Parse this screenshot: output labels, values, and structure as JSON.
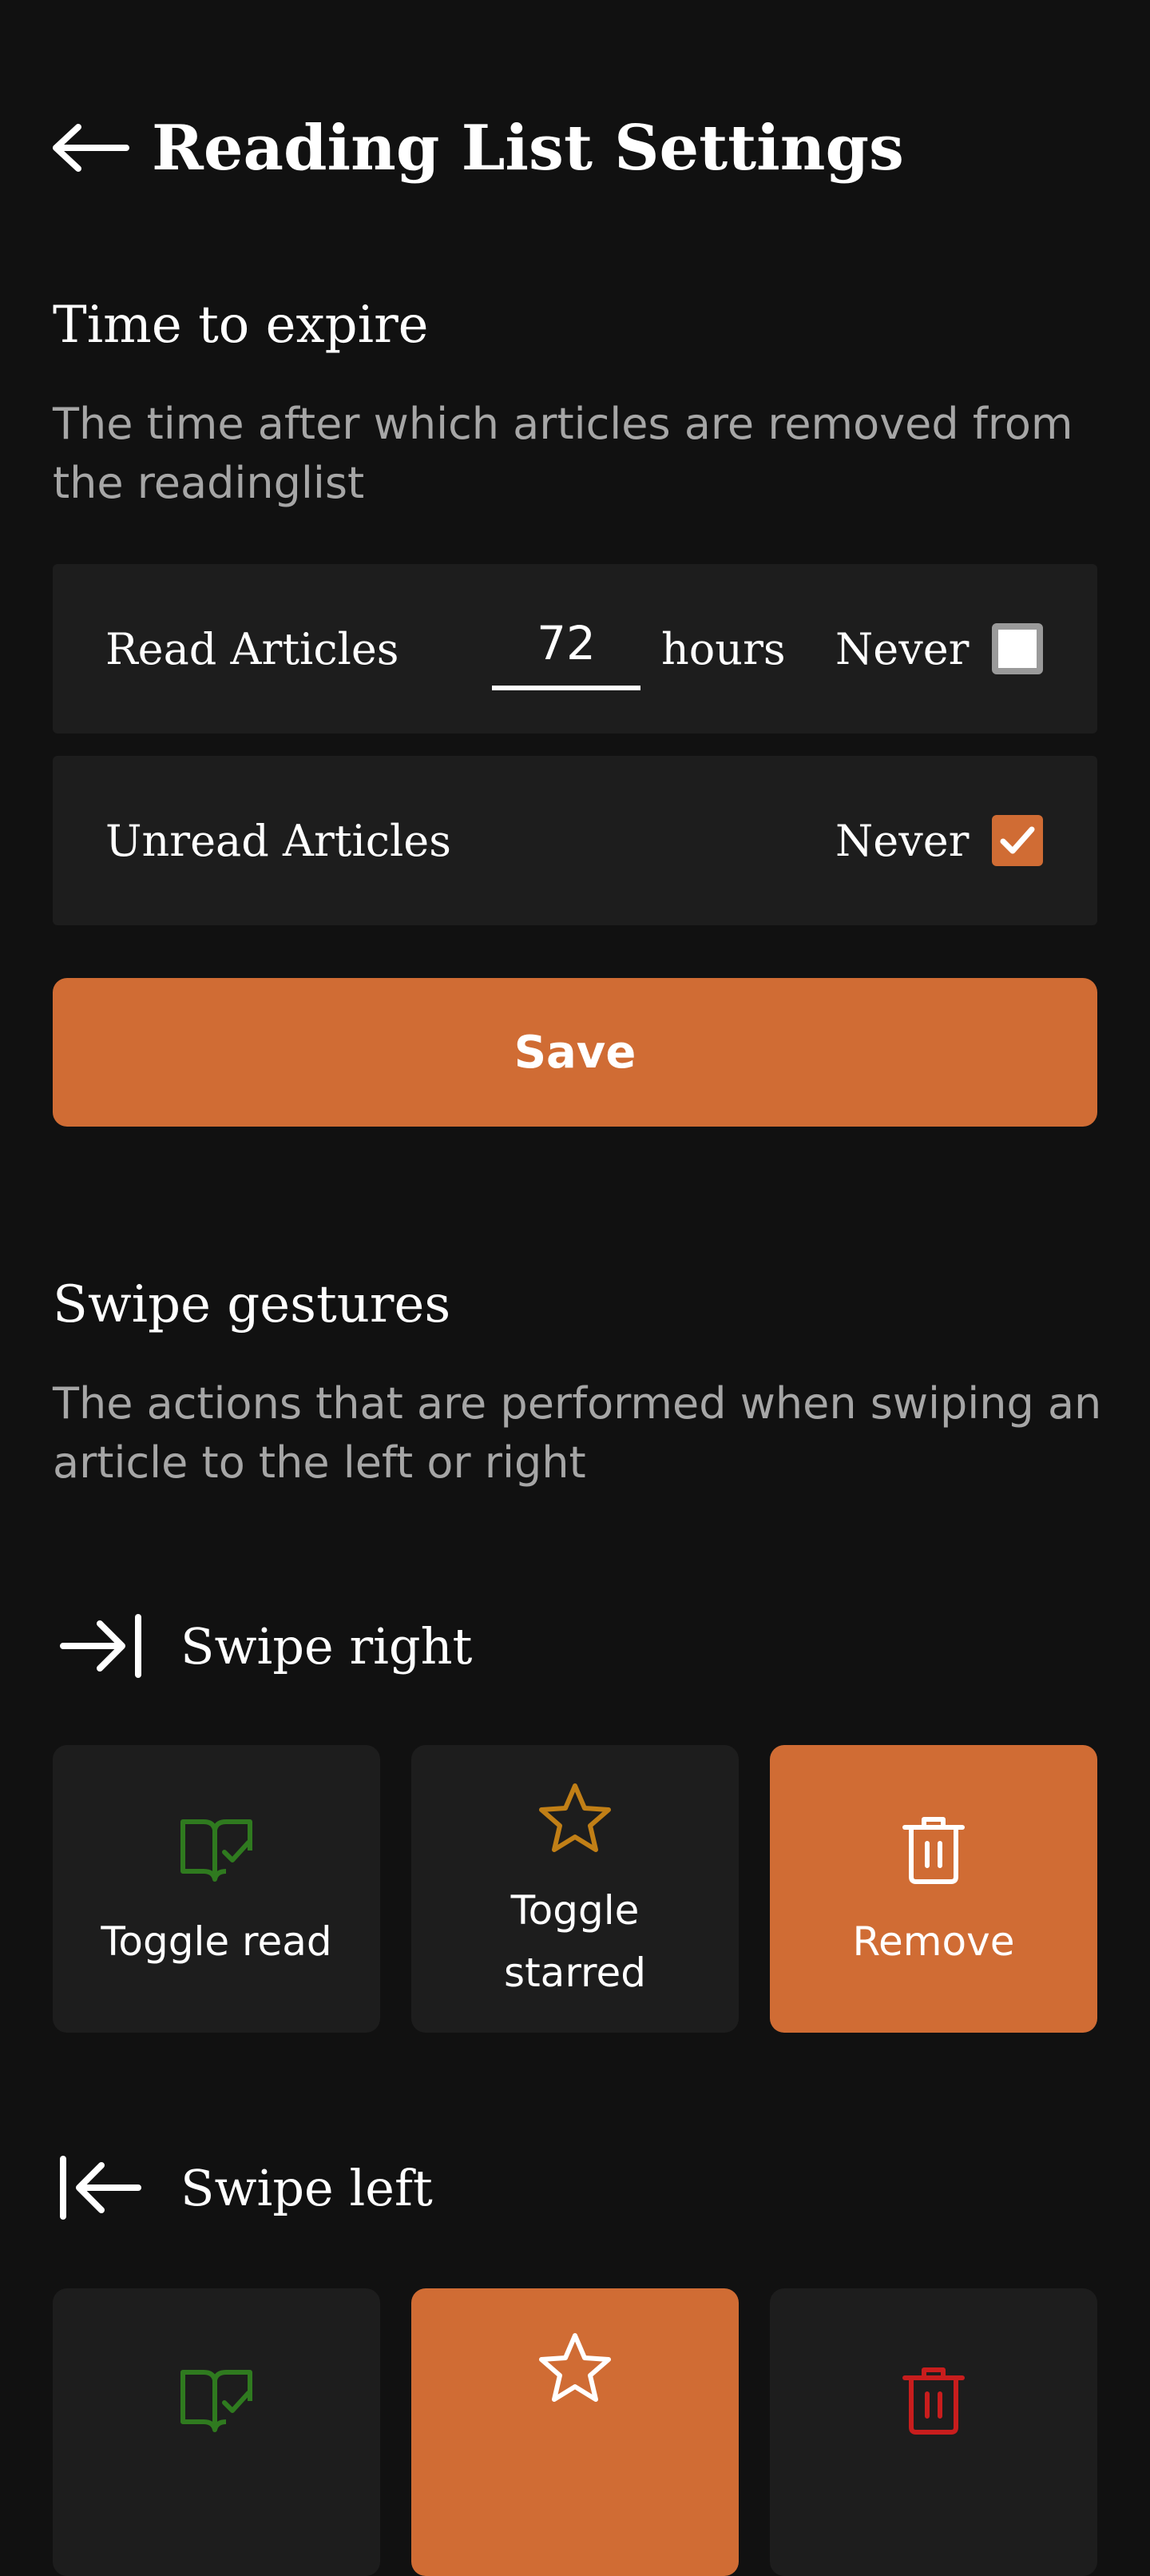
{
  "header": {
    "title": "Reading List Settings"
  },
  "expire": {
    "title": "Time to expire",
    "description": "The time after which articles are removed from the readinglist",
    "read_row": {
      "label": "Read Articles",
      "hours_value": "72",
      "unit": "hours",
      "never_label": "Never",
      "never_checked": false
    },
    "unread_row": {
      "label": "Unread Articles",
      "never_label": "Never",
      "never_checked": true
    },
    "save_label": "Save"
  },
  "swipe": {
    "title": "Swipe gestures",
    "description": "The actions that are performed when swiping an article to the left or right",
    "right": {
      "label": "Swipe right",
      "icon": "arrow-right-to-line-icon",
      "actions": [
        {
          "label": "Toggle read",
          "icon": "book-check-icon",
          "selected": false
        },
        {
          "label": "Toggle\nstarred",
          "icon": "star-icon",
          "selected": false
        },
        {
          "label": "Remove",
          "icon": "trash-icon",
          "selected": true
        }
      ]
    },
    "left": {
      "label": "Swipe left",
      "icon": "arrow-left-to-line-icon",
      "actions": [
        {
          "icon": "book-check-icon",
          "selected": false
        },
        {
          "icon": "star-icon",
          "selected": true
        },
        {
          "icon": "trash-icon",
          "selected": false
        }
      ]
    }
  },
  "colors": {
    "background": "#111111",
    "surface": "#1d1d1d",
    "accent": "#d06c34",
    "muted_text": "#a6a6a6",
    "read_icon": "#2f7a1f",
    "star_icon": "#c17f16",
    "delete_icon": "#c81d1d"
  }
}
